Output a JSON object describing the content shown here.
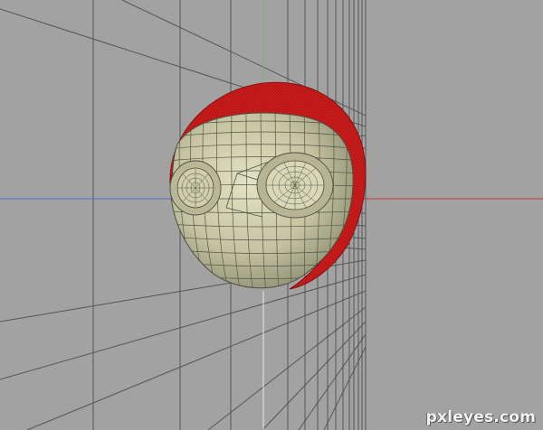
{
  "watermark": "pxleyes.com",
  "colors": {
    "background": "#a2a2a2",
    "grid_line": "#5a5a5a",
    "axis_x": "#c23a3a",
    "axis_y": "#7fb07f",
    "axis_z": "#4a72c8",
    "mesh_fill": "#c9c9a6",
    "mesh_wire": "#4e4e42",
    "shell_red": "#d62020"
  },
  "icons": {
    "model": "3d-eyeball-mesh"
  }
}
